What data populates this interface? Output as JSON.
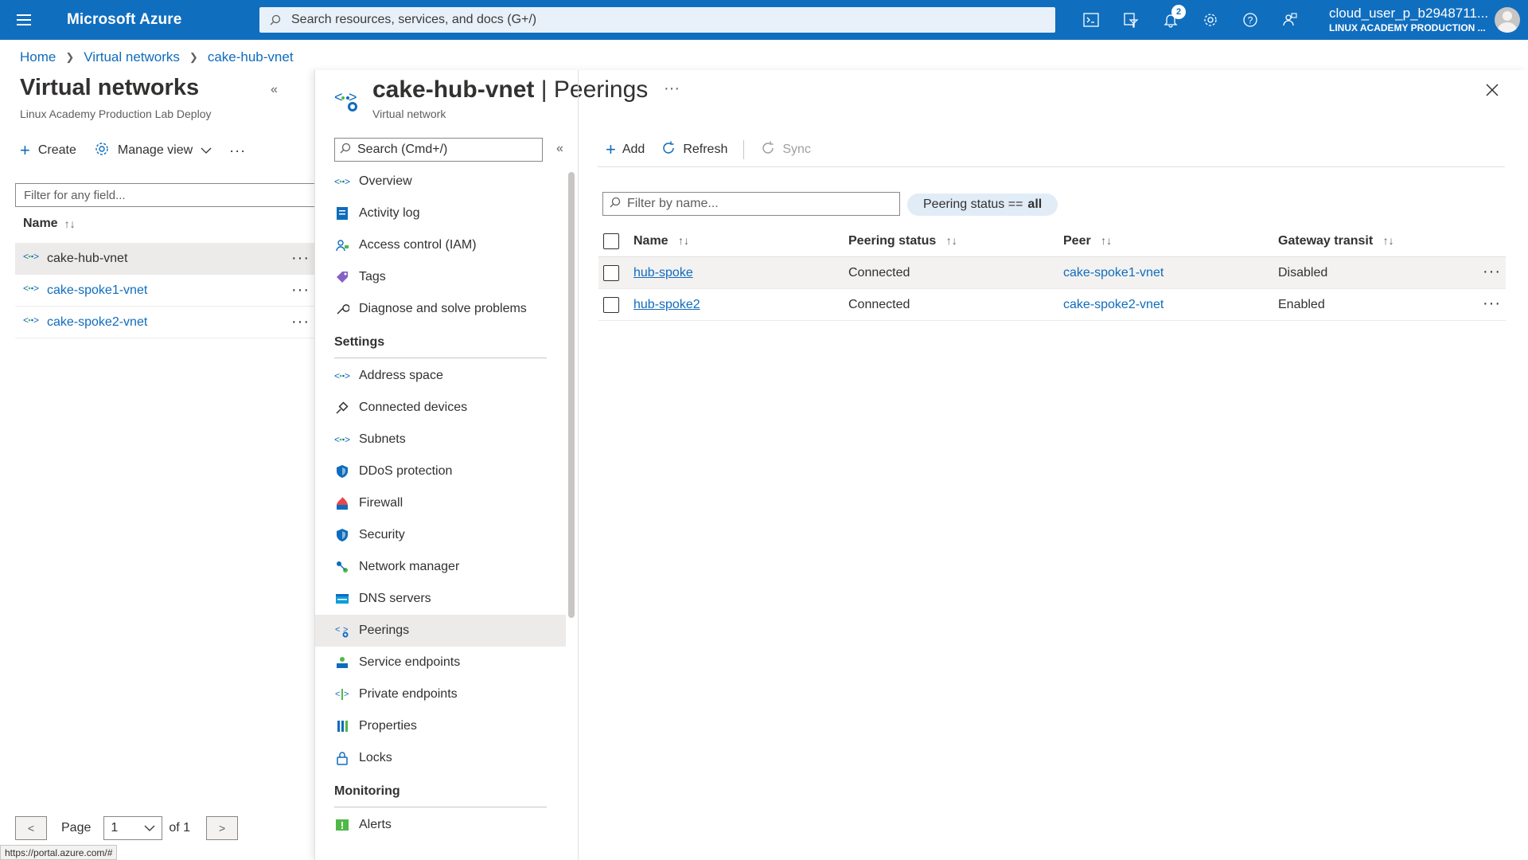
{
  "topbar": {
    "brand": "Microsoft Azure",
    "search_placeholder": "Search resources, services, and docs (G+/)",
    "notifications_count": "2",
    "user": "cloud_user_p_b2948711...",
    "tenant": "LINUX ACADEMY PRODUCTION ..."
  },
  "breadcrumb": [
    "Home",
    "Virtual networks",
    "cake-hub-vnet"
  ],
  "left": {
    "title": "Virtual networks",
    "subtitle": "Linux Academy Production Lab Deploy",
    "create_label": "Create",
    "manage_view_label": "Manage view",
    "filter_placeholder": "Filter for any field...",
    "column_name": "Name",
    "items": [
      {
        "name": "cake-hub-vnet",
        "selected": true
      },
      {
        "name": "cake-spoke1-vnet",
        "selected": false
      },
      {
        "name": "cake-spoke2-vnet",
        "selected": false
      }
    ],
    "pager": {
      "page_label": "Page",
      "page": "1",
      "of_label": "of 1",
      "prev": "<",
      "next": ">"
    }
  },
  "status_url": "https://portal.azure.com/#",
  "blade": {
    "resource": "cake-hub-vnet",
    "separator": "|",
    "page": "Peerings",
    "subtitle": "Virtual network",
    "menu_search_placeholder": "Search (Cmd+/)",
    "menu": [
      {
        "type": "item",
        "label": "Overview",
        "icon": "vnet-icon"
      },
      {
        "type": "item",
        "label": "Activity log",
        "icon": "activity-log-icon"
      },
      {
        "type": "item",
        "label": "Access control (IAM)",
        "icon": "iam-icon"
      },
      {
        "type": "item",
        "label": "Tags",
        "icon": "tag-icon"
      },
      {
        "type": "item",
        "label": "Diagnose and solve problems",
        "icon": "wrench-icon"
      },
      {
        "type": "section",
        "label": "Settings"
      },
      {
        "type": "item",
        "label": "Address space",
        "icon": "vnet-icon"
      },
      {
        "type": "item",
        "label": "Connected devices",
        "icon": "plug-icon"
      },
      {
        "type": "item",
        "label": "Subnets",
        "icon": "vnet-icon"
      },
      {
        "type": "item",
        "label": "DDoS protection",
        "icon": "shield-icon"
      },
      {
        "type": "item",
        "label": "Firewall",
        "icon": "firewall-icon"
      },
      {
        "type": "item",
        "label": "Security",
        "icon": "shield-icon"
      },
      {
        "type": "item",
        "label": "Network manager",
        "icon": "network-manager-icon"
      },
      {
        "type": "item",
        "label": "DNS servers",
        "icon": "dns-icon"
      },
      {
        "type": "item",
        "label": "Peerings",
        "icon": "peering-icon",
        "selected": true
      },
      {
        "type": "item",
        "label": "Service endpoints",
        "icon": "service-endpoint-icon"
      },
      {
        "type": "item",
        "label": "Private endpoints",
        "icon": "private-endpoint-icon"
      },
      {
        "type": "item",
        "label": "Properties",
        "icon": "properties-icon"
      },
      {
        "type": "item",
        "label": "Locks",
        "icon": "lock-icon"
      },
      {
        "type": "section",
        "label": "Monitoring"
      },
      {
        "type": "item",
        "label": "Alerts",
        "icon": "alert-icon"
      }
    ],
    "toolbar": {
      "add": "Add",
      "refresh": "Refresh",
      "sync": "Sync"
    },
    "filter_placeholder": "Filter by name...",
    "pill_label": "Peering status ==",
    "pill_value": "all",
    "columns": [
      "Name",
      "Peering status",
      "Peer",
      "Gateway transit"
    ],
    "rows": [
      {
        "name": "hub-spoke",
        "status": "Connected",
        "peer": "cake-spoke1-vnet",
        "gateway": "Disabled"
      },
      {
        "name": "hub-spoke2",
        "status": "Connected",
        "peer": "cake-spoke2-vnet",
        "gateway": "Enabled"
      }
    ]
  },
  "colors": {
    "topbar": "#106ebe",
    "link": "#0f6cbd",
    "selected": "#edebe9"
  }
}
